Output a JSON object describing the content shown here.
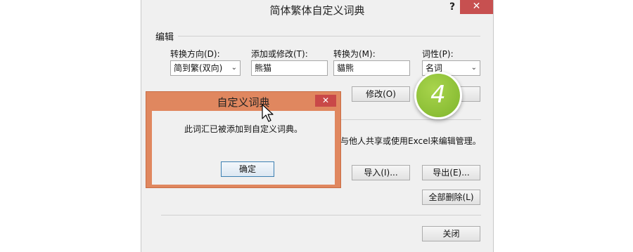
{
  "dialog": {
    "title": "简体繁体自定义词典",
    "help_label": "?",
    "close_label": "✕",
    "group_label": "编辑",
    "direction_label": "转换方向(D):",
    "direction_value": "简到繁(双向)",
    "add_modify_label": "添加或修改(T):",
    "add_modify_value": "熊猫",
    "convert_to_label": "转换为(M):",
    "convert_to_value": "貓熊",
    "pos_label": "词性(P):",
    "pos_value": "名词",
    "modify_button": "修改(O)",
    "share_text": "与他人共享或使用Excel来编辑管理。",
    "import_button": "导入(I)...",
    "export_button": "导出(E)...",
    "delete_all_button": "全部删除(L)",
    "close_button": "关闭"
  },
  "step_badge": "4",
  "message_box": {
    "title": "自定义词典",
    "close_label": "✕",
    "text": "此词汇已被添加到自定义词典。",
    "ok_button": "确定"
  },
  "colors": {
    "message_frame": "#e0875f",
    "close_button": "#c75050",
    "step_badge": "#8cc43a"
  },
  "icons": [
    "dropdown-arrow-icon",
    "close-icon",
    "mouse-cursor-icon"
  ]
}
